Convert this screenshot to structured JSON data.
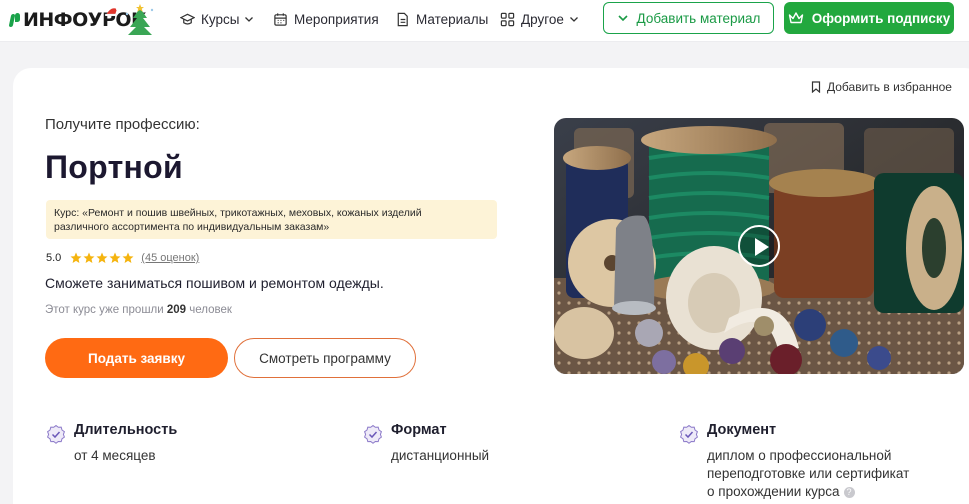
{
  "header": {
    "logo_text": "ИНФОУРОК",
    "nav": {
      "courses": "Курсы",
      "events": "Мероприятия",
      "materials": "Материалы",
      "other": "Другое"
    },
    "add_material": "Добавить материал",
    "subscribe": "Оформить подписку"
  },
  "course": {
    "favorite": "Добавить в избранное",
    "eyebrow": "Получите профессию:",
    "title": "Портной",
    "course_line1": "Курс: «Ремонт и пошив швейных, трикотажных, меховых, кожаных изделий",
    "course_line2": "различного ассортимента по индивидуальным заказам»",
    "rating": "5.0",
    "stars": 5,
    "reviews": "(45 оценок)",
    "benefit": "Сможете заниматься пошивом и ремонтом одежды.",
    "passed_prefix": "Этот курс уже прошли",
    "passed_count": "209",
    "passed_suffix": "человек",
    "apply_button": "Подать заявку",
    "program_button": "Смотреть программу"
  },
  "features": {
    "duration": {
      "title": "Длительность",
      "value": "от 4 месяцев"
    },
    "format": {
      "title": "Формат",
      "value": "дистанционный"
    },
    "document": {
      "title": "Документ",
      "line1": "диплом о профессиональной",
      "line2": "переподготовке или сертификат",
      "line3": "о прохождении курса",
      "hint": "?"
    }
  },
  "colors": {
    "brand_green": "#22a83e",
    "accent_orange": "#ff6a13",
    "course_box": "#fdf3d7",
    "star": "#f5b40f"
  }
}
